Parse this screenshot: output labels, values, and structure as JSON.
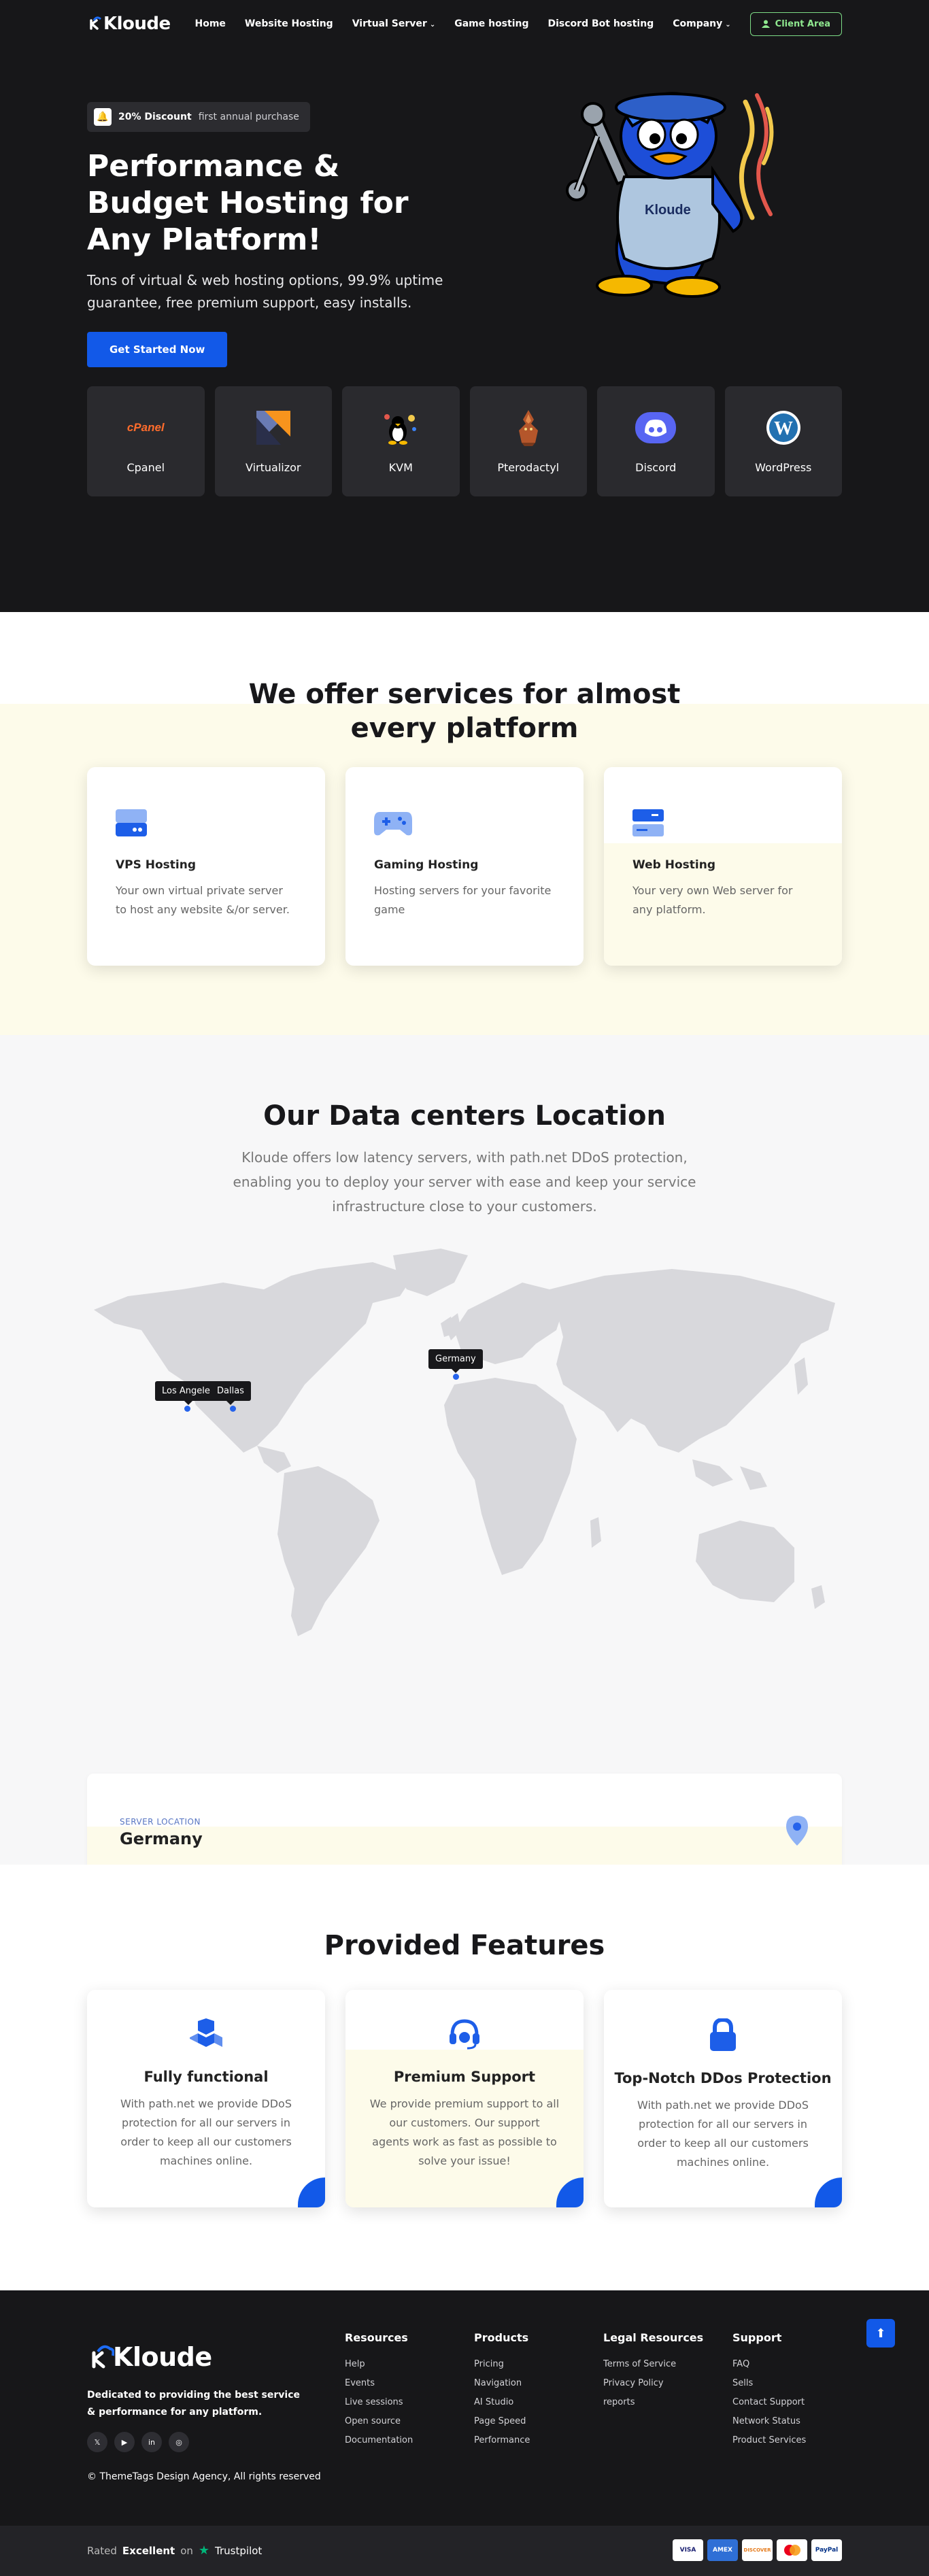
{
  "nav": {
    "logo": "Kloude",
    "items": [
      "Home",
      "Website Hosting",
      "Virtual Server",
      "Game hosting",
      "Discord Bot hosting",
      "Company"
    ],
    "client_area": "Client Area"
  },
  "hero": {
    "badge_bold": "20% Discount",
    "badge_rest": "first annual purchase",
    "title": "Performance & Budget Hosting for Any Platform!",
    "subtitle": "Tons of virtual & web hosting options, 99.9% uptime guarantee, free premium support, easy installs.",
    "cta": "Get Started Now",
    "mascot_shirt": "Kloude"
  },
  "platforms": [
    {
      "label": "Cpanel",
      "logo_text": "cPanel",
      "icon": "cpanel-logo"
    },
    {
      "label": "Virtualizor",
      "icon": "virtualizor-logo"
    },
    {
      "label": "KVM",
      "icon": "kvm-logo"
    },
    {
      "label": "Pterodactyl",
      "icon": "pterodactyl-logo"
    },
    {
      "label": "Discord",
      "icon": "discord-logo"
    },
    {
      "label": "WordPress",
      "icon": "wordpress-logo"
    }
  ],
  "services": {
    "title": "We offer services for almost every platform",
    "cards": [
      {
        "title": "VPS Hosting",
        "text": "Your own virtual private server to host any website &/or server.",
        "icon": "server-icon"
      },
      {
        "title": "Gaming Hosting",
        "text": "Hosting servers for your favorite game",
        "icon": "gamepad-icon"
      },
      {
        "title": "Web Hosting",
        "text": "Your very own Web server for any platform.",
        "icon": "web-server-icon"
      }
    ]
  },
  "datacenters": {
    "title": "Our Data centers Location",
    "lead": "Kloude offers low latency servers, with path.net DDoS protection, enabling you to deploy your server with ease and keep your service infrastructure close to your customers.",
    "markers": [
      "Los Angeles",
      "Dallas",
      "Germany"
    ],
    "card_label": "SERVER LOCATION",
    "card_location": "Germany"
  },
  "features": {
    "title": "Provided Features",
    "cards": [
      {
        "title": "Fully functional",
        "text": "With path.net we provide DDoS protection for all our servers in order to keep all our customers machines online.",
        "icon": "cubes-icon"
      },
      {
        "title": "Premium Support",
        "text": "We provide premium support to all our customers. Our support agents work as fast as possible to solve your issue!",
        "icon": "headset-icon"
      },
      {
        "title": "Top-Notch DDos Protection",
        "text": "With path.net we provide DDoS protection for all our servers in order to keep all our customers machines online.",
        "icon": "lock-icon"
      }
    ]
  },
  "footer": {
    "logo": "Kloude",
    "tagline": "Dedicated to providing the best service & performance for any platform.",
    "copyright": "© ThemeTags Design Agency, All rights reserved",
    "columns": [
      {
        "title": "Resources",
        "links": [
          "Help",
          "Events",
          "Live sessions",
          "Open source",
          "Documentation"
        ]
      },
      {
        "title": "Products",
        "links": [
          "Pricing",
          "Navigation",
          "AI Studio",
          "Page Speed",
          "Performance"
        ]
      },
      {
        "title": "Legal Resources",
        "links": [
          "Terms of Service",
          "Privacy Policy",
          "reports"
        ]
      },
      {
        "title": "Support",
        "links": [
          "FAQ",
          "Sells",
          "Contact Support",
          "Network Status",
          "Product Services"
        ]
      }
    ],
    "rated_prefix": "Rated",
    "rated_word": "Excellent",
    "rated_on": "on",
    "trustpilot": "Trustpilot",
    "payments": [
      "VISA",
      "AMEX",
      "DISCOVER",
      "MASTERCARD",
      "PayPal"
    ]
  },
  "colors": {
    "accent": "#1259e8",
    "dark": "#171719",
    "tint": "#fdfbea",
    "client_green": "#8fe88f"
  }
}
